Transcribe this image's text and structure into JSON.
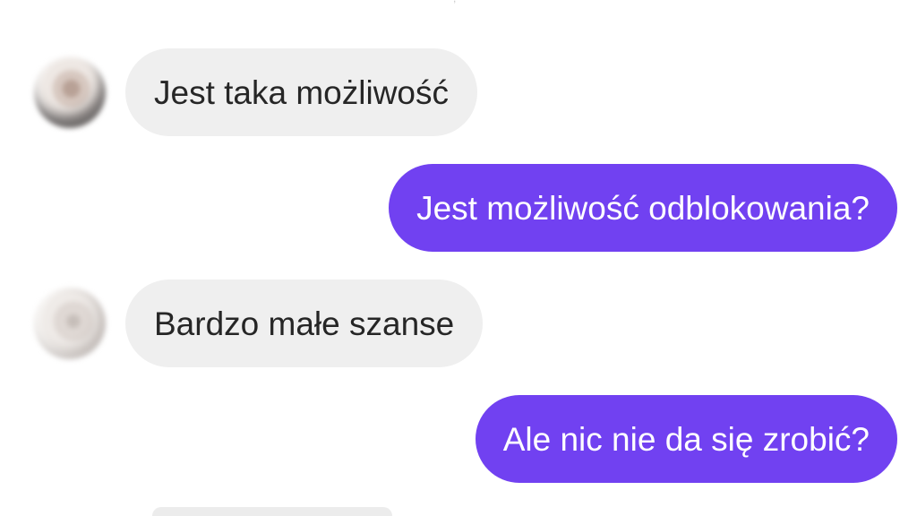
{
  "top_fragment": ",",
  "messages": [
    {
      "side": "incoming",
      "text": "Jest taka możliwość"
    },
    {
      "side": "outgoing",
      "text": "Jest możliwość odblokowania?"
    },
    {
      "side": "incoming",
      "text": "Bardzo małe szanse"
    },
    {
      "side": "outgoing",
      "text": "Ale nic nie da się zrobić?"
    }
  ],
  "colors": {
    "incoming_bubble": "#efefef",
    "outgoing_bubble": "#7141f1",
    "incoming_text": "#262626",
    "outgoing_text": "#ffffff"
  }
}
